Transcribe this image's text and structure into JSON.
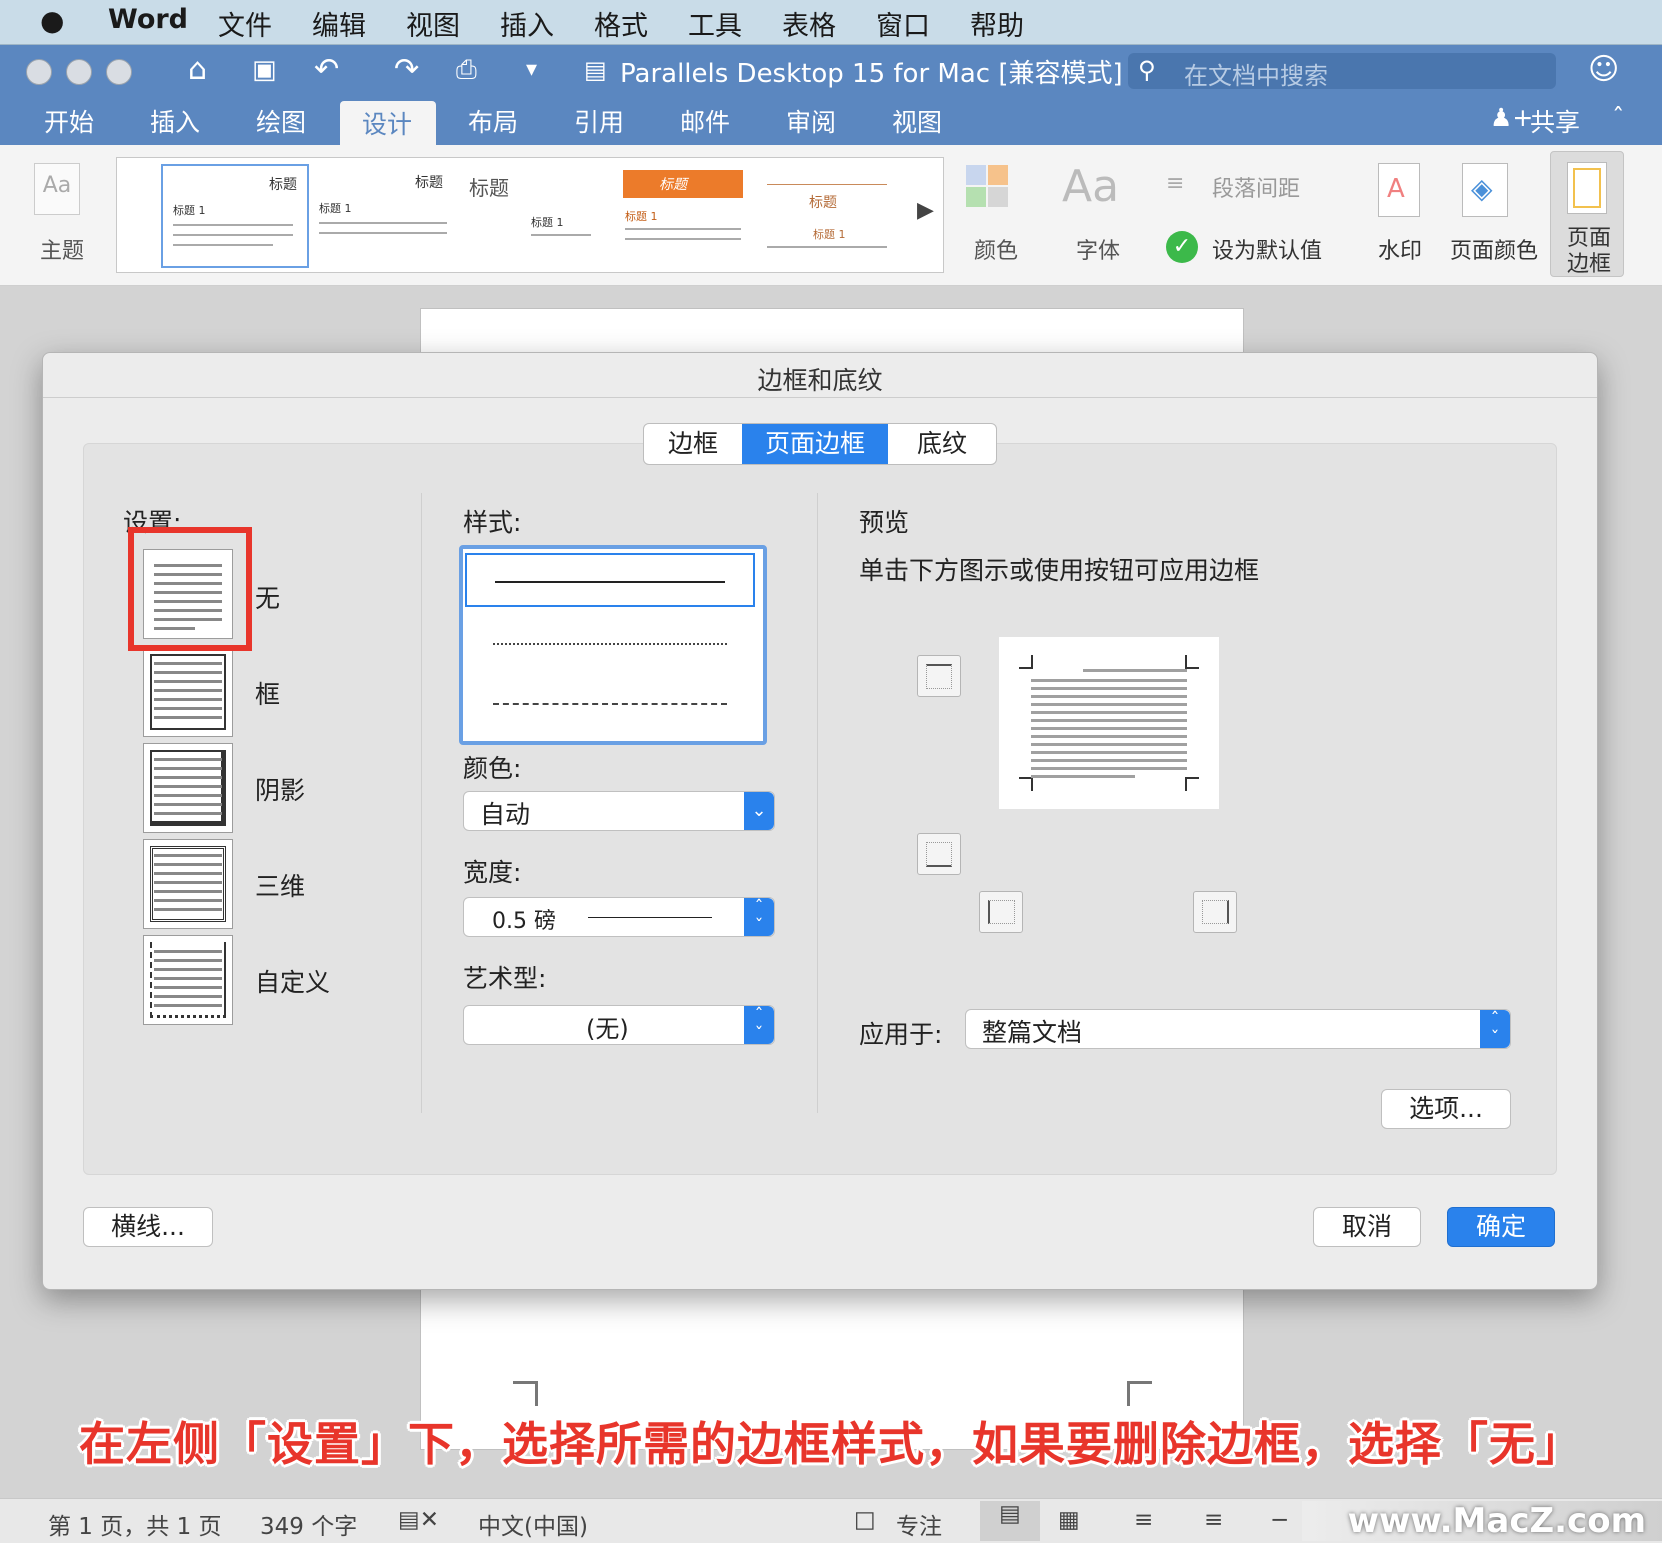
{
  "menubar": {
    "apple": "",
    "app": "Word",
    "items": [
      "文件",
      "编辑",
      "视图",
      "插入",
      "格式",
      "工具",
      "表格",
      "窗口",
      "帮助"
    ]
  },
  "titlebar": {
    "doc_title": "Parallels Desktop 15 for Mac [兼容模式]",
    "search_placeholder": "在文档中搜索"
  },
  "ribbon_tabs": [
    "开始",
    "插入",
    "绘图",
    "设计",
    "布局",
    "引用",
    "邮件",
    "审阅",
    "视图"
  ],
  "active_ribbon_tab": "设计",
  "share_label": "共享",
  "ribbon": {
    "theme_label": "主题",
    "gallery": [
      {
        "title": "标题",
        "sub": "标题 1"
      },
      {
        "title": "标题",
        "sub": "标题 1"
      },
      {
        "title": "标题",
        "sub": "标题 1"
      },
      {
        "title": "标题",
        "sub": "标题 1"
      },
      {
        "title": "标题",
        "sub": "标题 1"
      }
    ],
    "colors_label": "颜色",
    "fonts_label": "字体",
    "paragraph_spacing_label": "段落间距",
    "set_default_label": "设为默认值",
    "watermark_label": "水印",
    "page_color_label": "页面颜色",
    "page_border_label_1": "页面",
    "page_border_label_2": "边框"
  },
  "dialog": {
    "title": "边框和底纹",
    "tabs": [
      "边框",
      "页面边框",
      "底纹"
    ],
    "active_tab": "页面边框",
    "settings_label": "设置:",
    "settings": [
      "无",
      "框",
      "阴影",
      "三维",
      "自定义"
    ],
    "selected_setting": "无",
    "style_label": "样式:",
    "color_label": "颜色:",
    "color_value": "自动",
    "width_label": "宽度:",
    "width_value": "0.5 磅",
    "art_label": "艺术型:",
    "art_value": "(无)",
    "preview_label": "预览",
    "preview_hint": "单击下方图示或使用按钮可应用边框",
    "apply_to_label": "应用于:",
    "apply_to_value": "整篇文档",
    "options_button": "选项...",
    "horizontal_line_button": "横线...",
    "cancel_button": "取消",
    "ok_button": "确定"
  },
  "caption": "在左侧「设置」下，选择所需的边框样式，如果要删除边框，选择「无」",
  "statusbar": {
    "page": "第 1 页，共 1 页",
    "words": "349 个字",
    "language": "中文(中国)",
    "focus": "专注",
    "watermark_text": "www.MacZ.com"
  },
  "colors": {
    "accent": "#2a82ec",
    "ribbon_blue": "#5b87c0",
    "caption_red": "#e8352b"
  }
}
